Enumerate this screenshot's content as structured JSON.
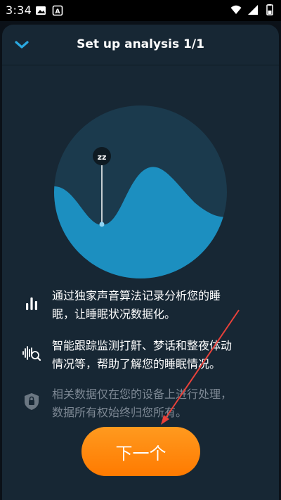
{
  "status_bar": {
    "time": "3:34",
    "left_icons": [
      "image-icon",
      "app-a-icon"
    ],
    "right_icons": [
      "wifi-icon",
      "signal-icon",
      "battery-icon"
    ]
  },
  "sheet": {
    "title": "Set up analysis 1/1",
    "collapse_icon": "chevron-down-icon"
  },
  "features": [
    {
      "icon": "bar-chart-icon",
      "text_line1": "通过独家声音算法记录分析您的睡",
      "text_line2": "眠，让睡眠状况数据化。"
    },
    {
      "icon": "sound-wave-search-icon",
      "text_line1": "智能跟踪监测打鼾、梦话和整夜体动",
      "text_line2": "情况等，帮助了解您的睡眠情况。"
    },
    {
      "icon": "lock-icon",
      "text_line1": "相关数据仅在您的设备上进行处理，",
      "text_line2": "数据所有权始终归您所有。"
    }
  ],
  "next_button": {
    "label": "下一个"
  },
  "colors": {
    "sheet_bg": "#172734",
    "wave": "#1c8fc0",
    "circle": "#1b3a4d",
    "accent_chevron": "#2aa8e0",
    "button": "#ff8a0f",
    "annotation_arrow": "#e8413a"
  }
}
